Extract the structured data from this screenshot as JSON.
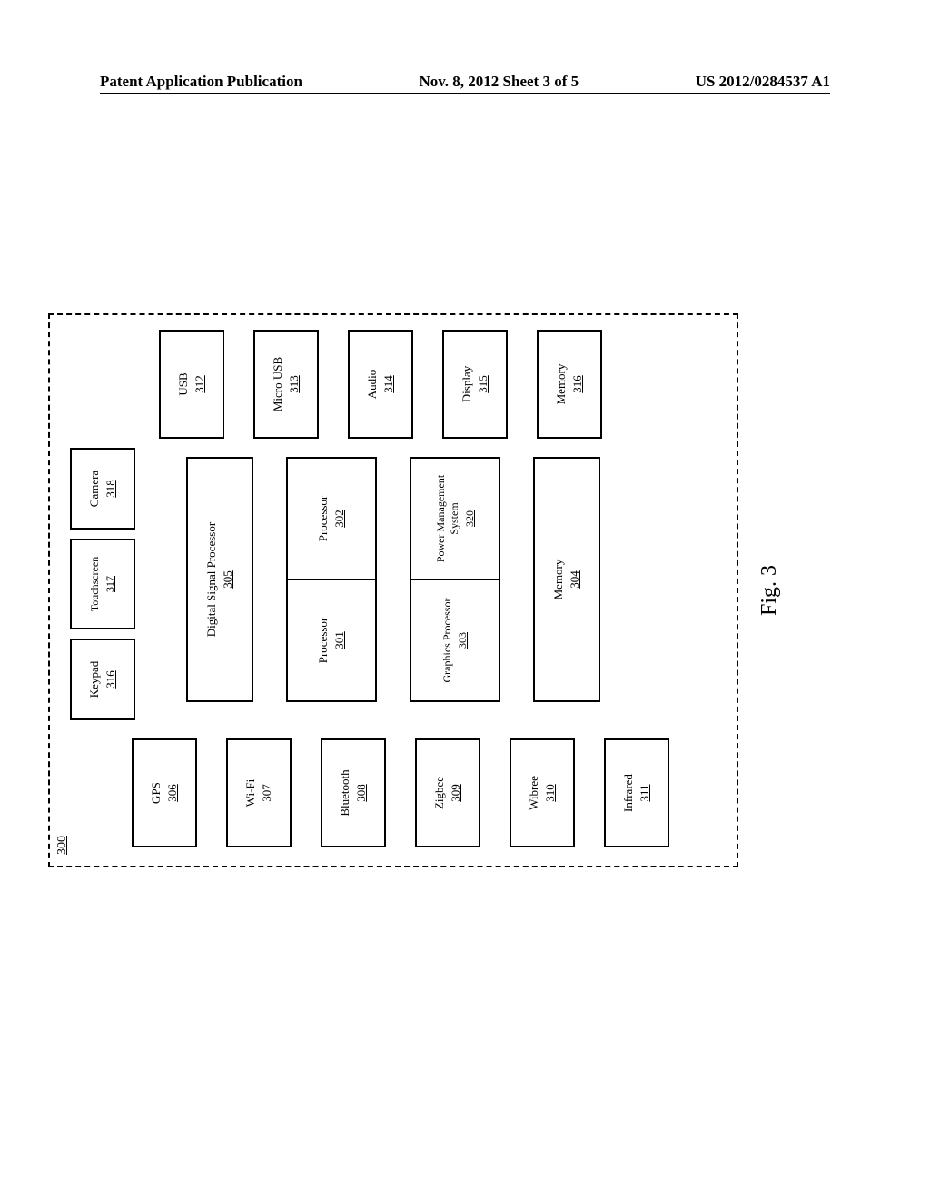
{
  "header": {
    "left": "Patent Application Publication",
    "center": "Nov. 8, 2012  Sheet 3 of 5",
    "right": "US 2012/0284537 A1"
  },
  "figure_label": "Fig. 3",
  "device_ref": "300",
  "blocks": {
    "gps": {
      "label": "GPS",
      "ref": "306"
    },
    "wifi": {
      "label": "Wi-Fi",
      "ref": "307"
    },
    "bluetooth": {
      "label": "Bluetooth",
      "ref": "308"
    },
    "zigbee": {
      "label": "Zigbee",
      "ref": "309"
    },
    "wibree": {
      "label": "Wibree",
      "ref": "310"
    },
    "infrared": {
      "label": "Infrared",
      "ref": "311"
    },
    "keypad": {
      "label": "Keypad",
      "ref": "316"
    },
    "touchscreen": {
      "label": "Touchscreen",
      "ref": "317"
    },
    "camera": {
      "label": "Camera",
      "ref": "318"
    },
    "dsp": {
      "label": "Digital Signal Processor",
      "ref": "305"
    },
    "proc1": {
      "label": "Processor",
      "ref": "301"
    },
    "proc2": {
      "label": "Processor",
      "ref": "302"
    },
    "gfx": {
      "label": "Graphics Processor",
      "ref": "303"
    },
    "pms": {
      "label": "Power Management System",
      "ref": "320"
    },
    "mem_main": {
      "label": "Memory",
      "ref": "304"
    },
    "usb": {
      "label": "USB",
      "ref": "312"
    },
    "microusb": {
      "label": "Micro USB",
      "ref": "313"
    },
    "audio": {
      "label": "Audio",
      "ref": "314"
    },
    "display": {
      "label": "Display",
      "ref": "315"
    },
    "memory": {
      "label": "Memory",
      "ref": "316"
    }
  }
}
